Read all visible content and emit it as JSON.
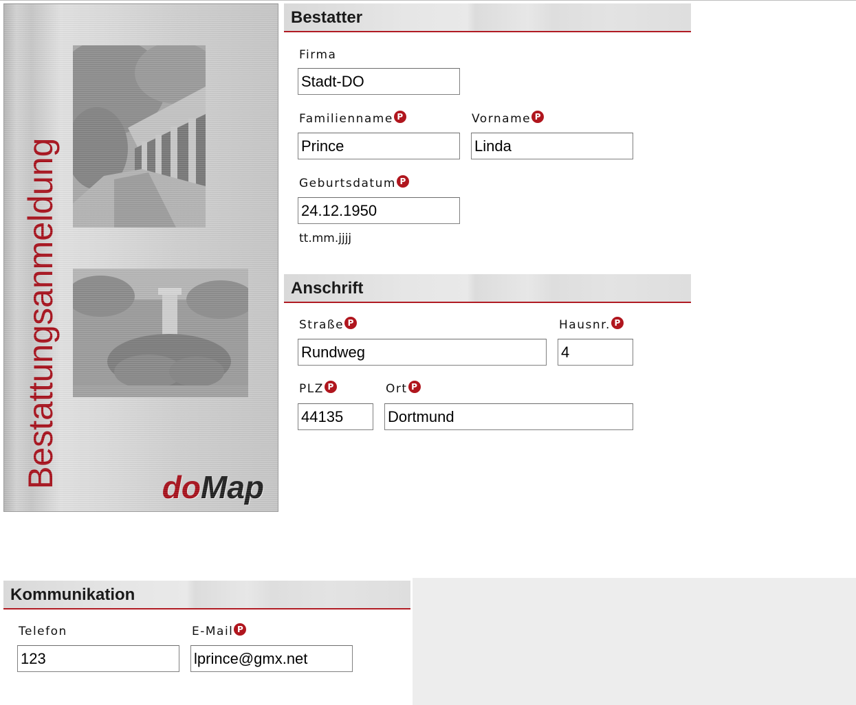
{
  "banner": {
    "title": "Bestattungsanmeldung",
    "logo_do": "do",
    "logo_map": "Map"
  },
  "sections": {
    "bestatter": "Bestatter",
    "anschrift": "Anschrift",
    "kommunikation": "Kommunikation"
  },
  "required_marker": "P",
  "fields": {
    "firma": {
      "label": "Firma",
      "value": "Stadt-DO"
    },
    "familienname": {
      "label": "Familienname",
      "value": "Prince"
    },
    "vorname": {
      "label": "Vorname",
      "value": "Linda"
    },
    "geburtsdatum": {
      "label": "Geburtsdatum",
      "value": "24.12.1950",
      "hint": "tt.mm.jjjj"
    },
    "strasse": {
      "label": "Straße",
      "value": "Rundweg"
    },
    "hausnr": {
      "label": "Hausnr.",
      "value": "4"
    },
    "plz": {
      "label": "PLZ",
      "value": "44135"
    },
    "ort": {
      "label": "Ort",
      "value": "Dortmund"
    },
    "telefon": {
      "label": "Telefon",
      "value": "123"
    },
    "email": {
      "label": "E-Mail",
      "value": "lprince@gmx.net"
    }
  },
  "colors": {
    "accent_red": "#a8121d",
    "header_gray": "#e3e3e3",
    "panel_gray": "#ededed"
  }
}
